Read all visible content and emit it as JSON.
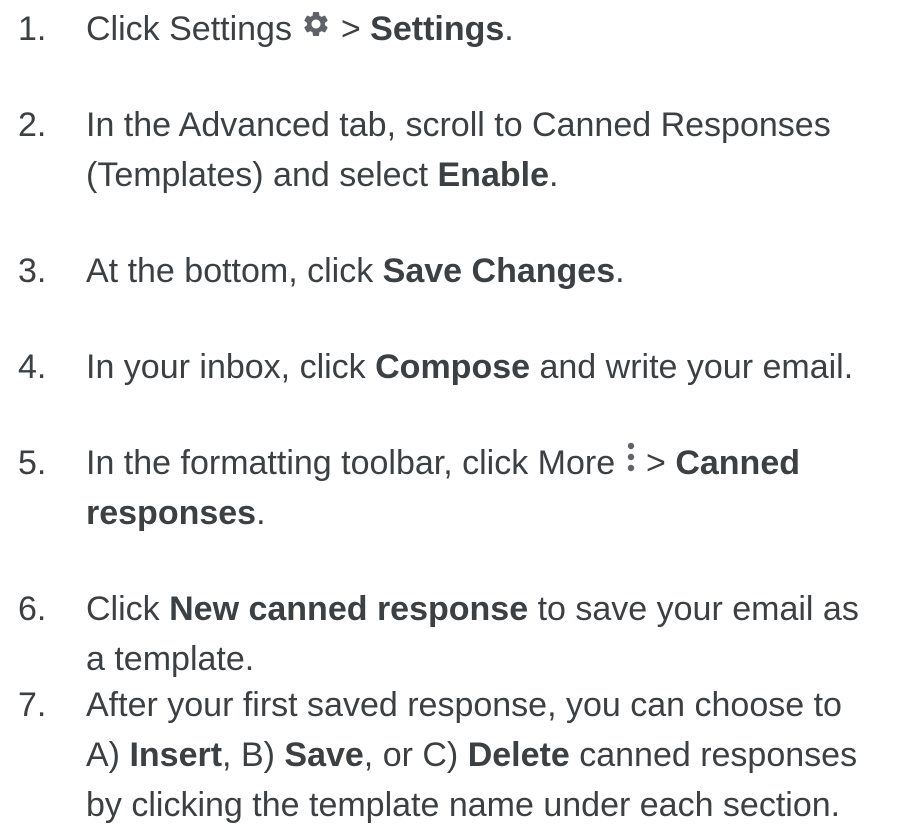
{
  "steps": [
    {
      "number": "1.",
      "segments": [
        {
          "text": "Click Settings "
        },
        {
          "icon": "gear-icon"
        },
        {
          "text": " > "
        },
        {
          "text": "Settings",
          "bold": true
        },
        {
          "text": "."
        }
      ]
    },
    {
      "number": "2.",
      "line1": [
        {
          "text": "In the Advanced tab, scroll to Canned Responses"
        }
      ],
      "line2": [
        {
          "text": "(Templates) and select "
        },
        {
          "text": "Enable",
          "bold": true
        },
        {
          "text": "."
        }
      ]
    },
    {
      "number": "3.",
      "segments": [
        {
          "text": "At the bottom, click "
        },
        {
          "text": "Save Changes",
          "bold": true
        },
        {
          "text": "."
        }
      ]
    },
    {
      "number": "4.",
      "segments": [
        {
          "text": "In your inbox, click "
        },
        {
          "text": "Compose",
          "bold": true
        },
        {
          "text": " and write your email."
        }
      ]
    },
    {
      "number": "5.",
      "line1": [
        {
          "text": "In the formatting toolbar, click More "
        },
        {
          "icon": "more-vertical-icon"
        },
        {
          "text": " > "
        },
        {
          "text": "Canned",
          "bold": true
        }
      ],
      "line2": [
        {
          "text": "responses",
          "bold": true
        },
        {
          "text": "."
        }
      ]
    },
    {
      "number": "6.",
      "line1": [
        {
          "text": "Click "
        },
        {
          "text": "New canned response",
          "bold": true
        },
        {
          "text": " to save your email as"
        }
      ],
      "line2": [
        {
          "text": "a template."
        }
      ]
    },
    {
      "number": "7.",
      "line1": [
        {
          "text": "After your first saved response, you can choose to"
        }
      ],
      "line2": [
        {
          "text": "A) "
        },
        {
          "text": "Insert",
          "bold": true
        },
        {
          "text": ", B) "
        },
        {
          "text": "Save",
          "bold": true
        },
        {
          "text": ", or C) "
        },
        {
          "text": "Delete",
          "bold": true
        },
        {
          "text": " canned responses"
        }
      ],
      "line3": [
        {
          "text": "by clicking the template name under each section."
        }
      ]
    }
  ],
  "colors": {
    "text": "#3c4043",
    "icon": "#5f6368"
  }
}
